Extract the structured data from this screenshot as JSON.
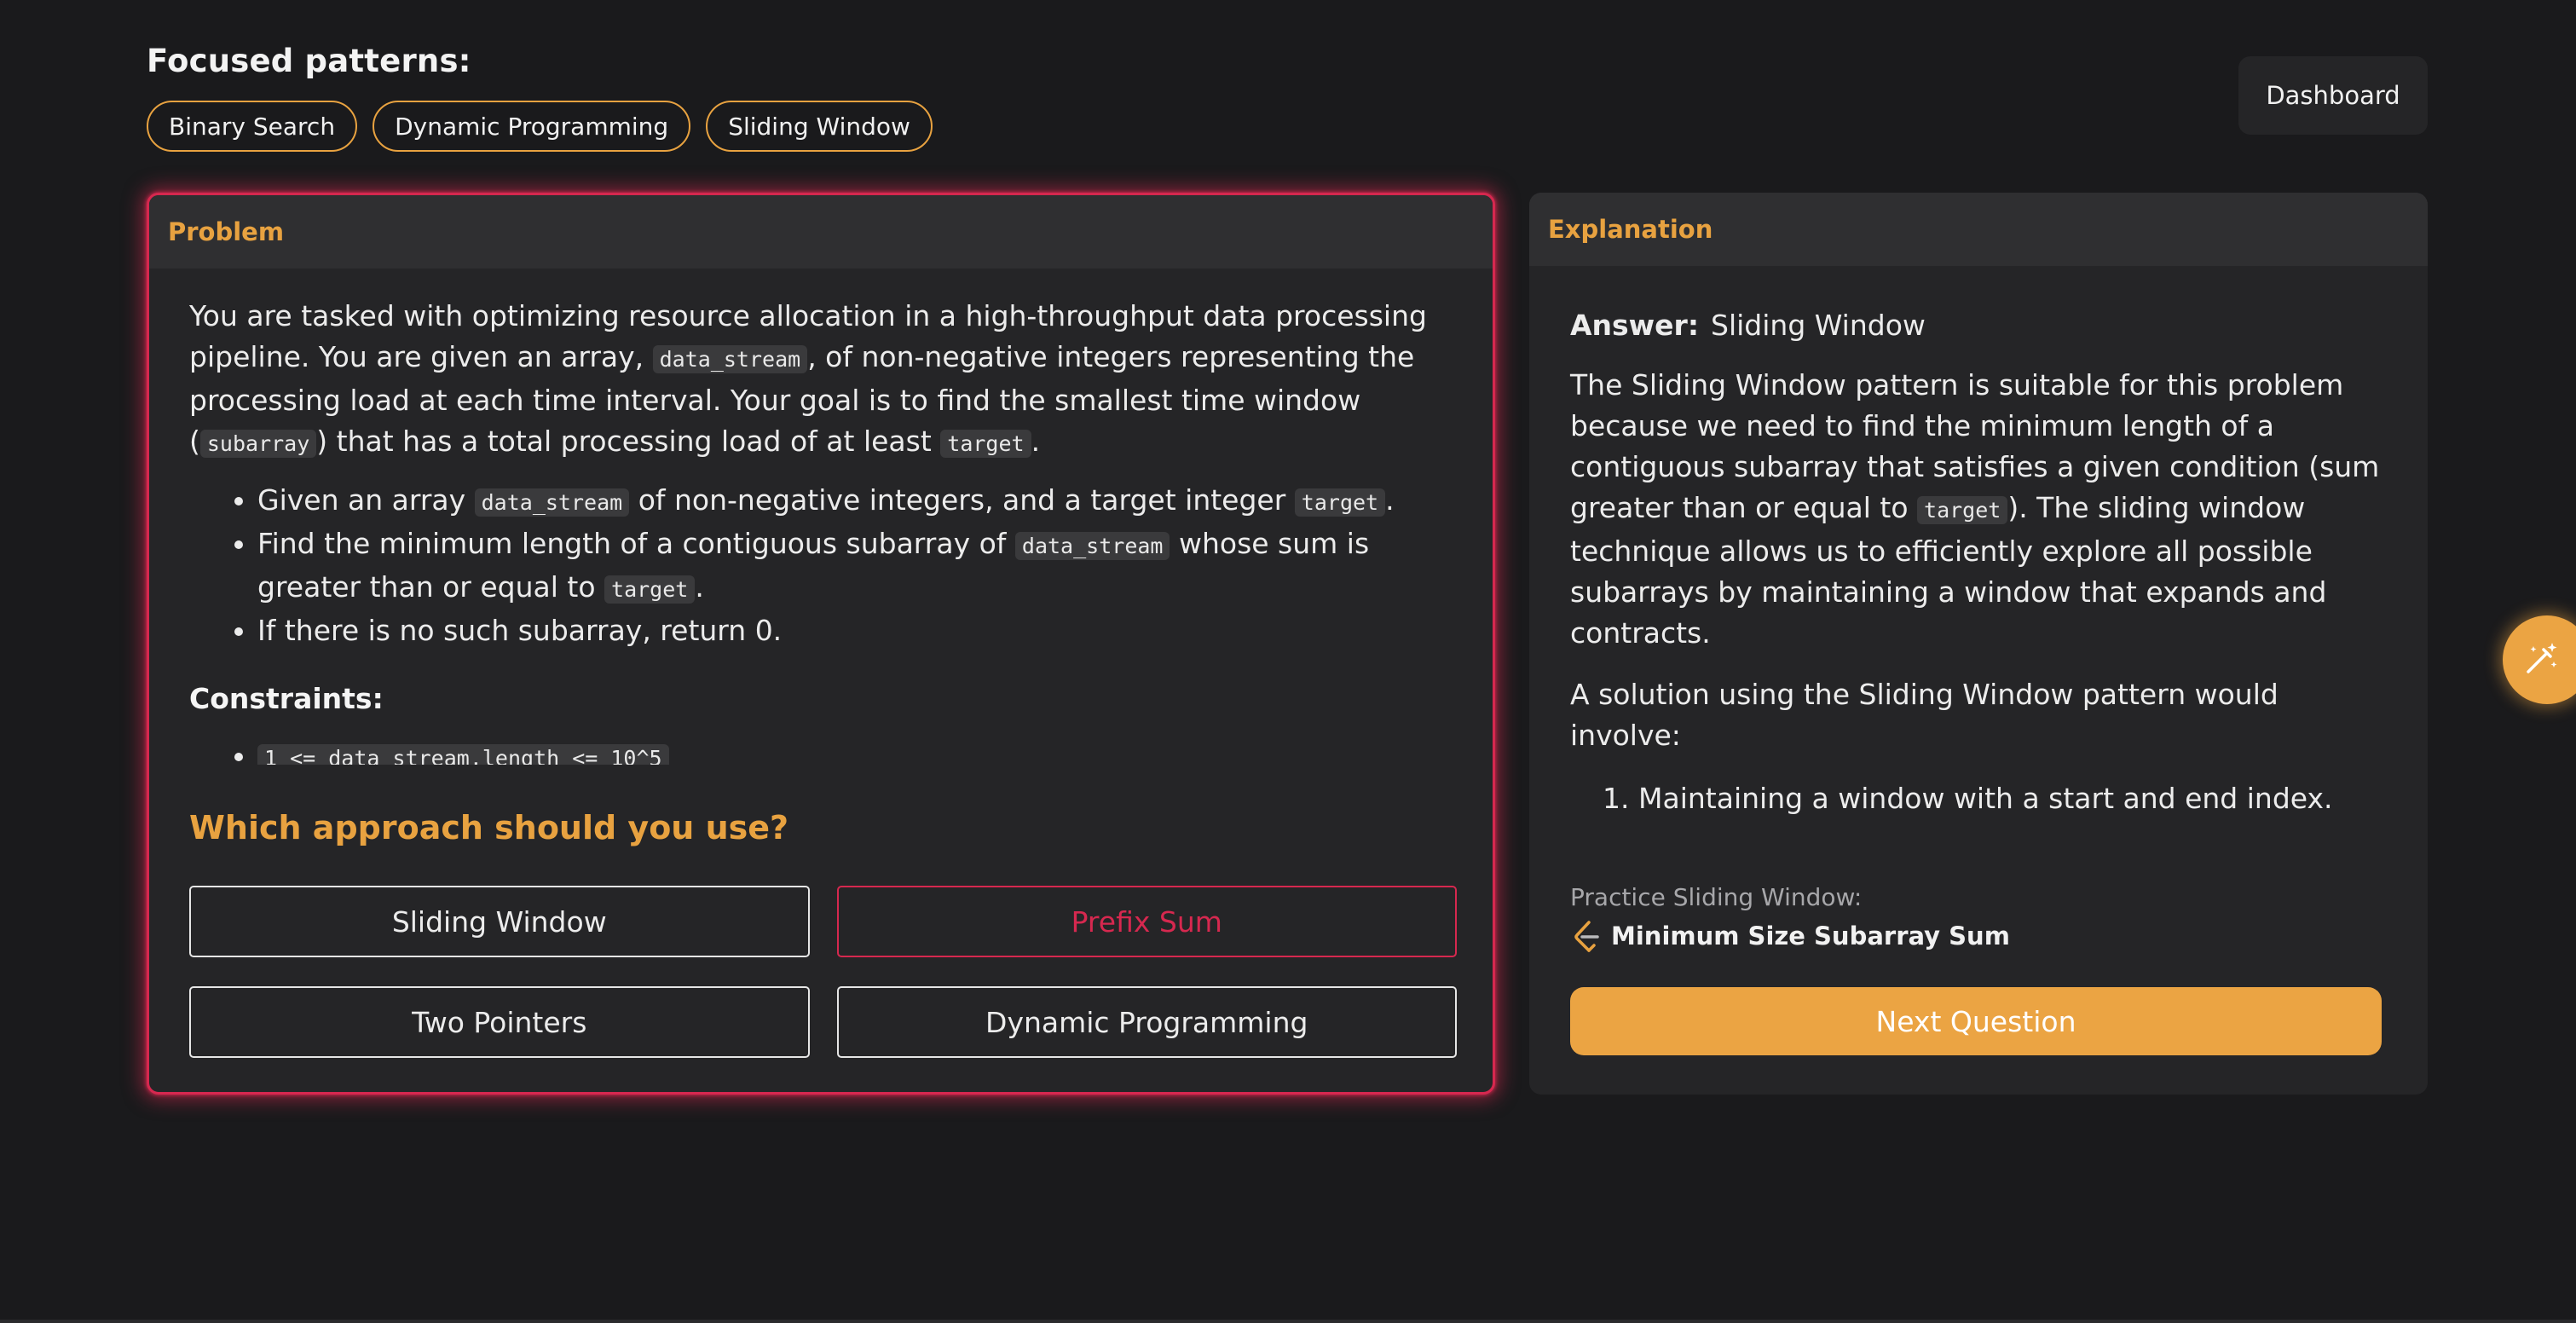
{
  "header": {
    "focused_title": "Focused patterns:",
    "tags": [
      "Binary Search",
      "Dynamic Programming",
      "Sliding Window"
    ],
    "dashboard_label": "Dashboard"
  },
  "problem": {
    "header": "Problem",
    "intro": {
      "p1": "You are tasked with optimizing resource allocation in a high-throughput data processing pipeline. You are given an array, ",
      "code1": "data_stream",
      "p2": ", of non-negative integers representing the processing load at each time interval. Your goal is to find the smallest time window (",
      "code2": "subarray",
      "p3": ") that has a total processing load of at least ",
      "code3": "target",
      "p4": "."
    },
    "bullets": {
      "b1_a": "Given an array ",
      "b1_code1": "data_stream",
      "b1_b": " of non-negative integers, and a target integer ",
      "b1_code2": "target",
      "b1_c": ".",
      "b2_a": "Find the minimum length of a contiguous subarray of ",
      "b2_code1": "data_stream",
      "b2_b": " whose sum is greater than or equal to ",
      "b2_code2": "target",
      "b2_c": ".",
      "b3": "If there is no such subarray, return 0."
    },
    "constraints_title": "Constraints:",
    "constraint_1": "1 <= data_stream.length <= 10^5",
    "question": "Which approach should you use?",
    "options": [
      "Sliding Window",
      "Prefix Sum",
      "Two Pointers",
      "Dynamic Programming"
    ],
    "wrong_option_color": "#d6284f"
  },
  "explanation": {
    "header": "Explanation",
    "answer_label": "Answer:",
    "answer_value": "Sliding Window",
    "para1_a": "The Sliding Window pattern is suitable for this problem because we need to find the minimum length of a contiguous subarray that satisfies a given condition (sum greater than or equal to ",
    "para1_code": "target",
    "para1_b": "). The sliding window technique allows us to efficiently explore all possible subarrays by maintaining a window that expands and contracts.",
    "para2": "A solution using the Sliding Window pattern would involve:",
    "step1": "Maintaining a window with a start and end index.",
    "practice_label": "Practice Sliding Window:",
    "practice_link": "Minimum Size Subarray Sum",
    "next_label": "Next Question"
  },
  "colors": {
    "accent": "#e8a240",
    "error": "#d6284f",
    "background": "#1a1a1c",
    "panel": "#252527"
  },
  "icons": {
    "practice": "leetcode-icon",
    "fab": "magic-wand-icon"
  }
}
